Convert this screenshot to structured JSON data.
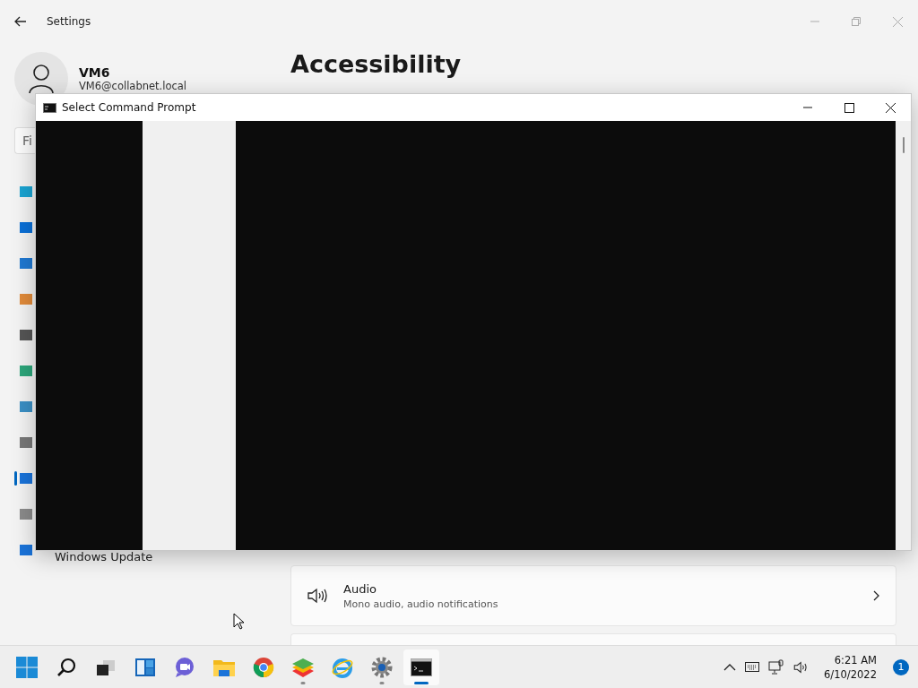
{
  "settings_window": {
    "title": "Settings",
    "user": {
      "name": "VM6",
      "email": "VM6@collabnet.local"
    },
    "search": {
      "placeholder": "Fi"
    },
    "sidebar": {
      "items": [
        {
          "color": "#1aa3d1",
          "selected": false
        },
        {
          "color": "#0a6fd6",
          "selected": false
        },
        {
          "color": "#1f78d1",
          "selected": false
        },
        {
          "color": "#e08a3a",
          "selected": false
        },
        {
          "color": "#555555",
          "selected": false
        },
        {
          "color": "#2ca57a",
          "selected": false
        },
        {
          "color": "#3b8fc4",
          "selected": false
        },
        {
          "color": "#777777",
          "selected": false
        },
        {
          "color": "#1a73d9",
          "selected": true
        },
        {
          "color": "#8a8a8a",
          "selected": false
        },
        {
          "color": "#1a73d9",
          "selected": false,
          "label": "Windows Update"
        }
      ]
    },
    "page_title": "Accessibility",
    "cards": [
      {
        "title": "Audio",
        "subtitle": "Mono audio, audio notifications"
      }
    ]
  },
  "console_window": {
    "title": "Select Command Prompt"
  },
  "taskbar": {
    "apps": [
      {
        "kind": "start",
        "running": false,
        "active": false
      },
      {
        "kind": "search",
        "running": false,
        "active": false
      },
      {
        "kind": "taskview",
        "running": false,
        "active": false
      },
      {
        "kind": "widgets",
        "running": false,
        "active": false
      },
      {
        "kind": "chat",
        "running": false,
        "active": false
      },
      {
        "kind": "explorer",
        "running": false,
        "active": false
      },
      {
        "kind": "chrome",
        "running": false,
        "active": false
      },
      {
        "kind": "bluestacks",
        "running": true,
        "active": false
      },
      {
        "kind": "ie",
        "running": false,
        "active": false
      },
      {
        "kind": "settings",
        "running": true,
        "active": false
      },
      {
        "kind": "console",
        "running": true,
        "active": true
      }
    ],
    "time": "6:21 AM",
    "date": "6/10/2022",
    "notifications": "1"
  }
}
